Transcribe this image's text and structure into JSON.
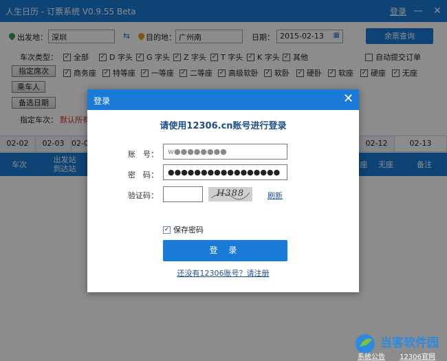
{
  "window": {
    "title": "人生日历 - 订票系统 V0.9.55 Beta",
    "login": "登录"
  },
  "search": {
    "from_label": "出发地：",
    "from_value": "深圳",
    "to_label": "目的地：",
    "to_value": "广州南",
    "date_label": "日期：",
    "date_value": "2015-02-13",
    "query_button": "余票查询",
    "train_type_label": "车次类型：",
    "train_types": [
      "全部",
      "D 字头",
      "G 字头",
      "Z 字头",
      "T 字头",
      "K 字头",
      "其他"
    ],
    "auto_submit": "自动提交订单",
    "seat_button": "指定席次",
    "seats": [
      "商务座",
      "特等座",
      "一等座",
      "二等座",
      "高级软卧",
      "软卧",
      "硬卧",
      "软座",
      "硬座",
      "无座"
    ],
    "passenger_button": "乘车人",
    "alt_date_button": "备选日期",
    "train_label": "指定车次：",
    "train_value": "默认所有"
  },
  "dates": [
    "02-02",
    "02-03",
    "02-0",
    "02-12",
    "02-13"
  ],
  "table_headers": {
    "train": "车次",
    "stations_1": "出发站",
    "stations_2": "到达站",
    "seat_a": "座",
    "no_seat": "无座",
    "remark": "备注"
  },
  "dialog": {
    "title": "登录",
    "heading": "请使用12306.cn账号进行登录",
    "account_label": "账　号：",
    "account_value": "w●●●●●●●●",
    "password_label": "密　码：",
    "password_value": "●●●●●●●●●●●●●●●●●",
    "captcha_label": "验证码：",
    "captcha_text": "H388",
    "refresh": "刷新",
    "save_password": "保存密码",
    "login_button": "登 录",
    "register_link": "还没有12306账号？请注册"
  },
  "watermark": {
    "text": "当客软件园",
    "links": [
      "系统公告",
      "12306官网"
    ]
  },
  "colors": {
    "primary": "#1a7ad8",
    "link": "#1d4f96",
    "red": "#d0312d"
  }
}
